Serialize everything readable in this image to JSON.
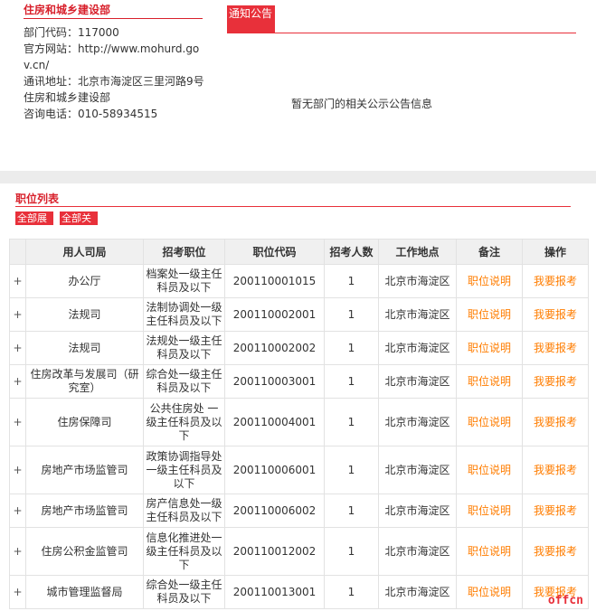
{
  "department": {
    "title": "住房和城乡建设部",
    "code_line": "部门代码：117000",
    "website_line": "官方网站：http://www.mohurd.gov.cn/",
    "address_line": "通讯地址：北京市海淀区三里河路9号住房和城乡建设部",
    "phone_line": "咨询电话：010-58934515"
  },
  "notice": {
    "tab_label": "通知公告",
    "empty_text": "暂无部门的相关公示公告信息"
  },
  "jobs": {
    "section_title": "职位列表",
    "expand_all": "全部展",
    "collapse_all": "全部关",
    "headers": [
      "用人司局",
      "招考职位",
      "职位代码",
      "招考人数",
      "工作地点",
      "备注",
      "操作"
    ],
    "rows": [
      {
        "expand": "+",
        "dept": "办公厅",
        "position": "档案处一级主任科员及以下",
        "code": "200110001015",
        "count": "1",
        "location": "北京市海淀区",
        "note": "职位说明",
        "action": "我要报考"
      },
      {
        "expand": "+",
        "dept": "法规司",
        "position": "法制协调处一级主任科员及以下",
        "code": "200110002001",
        "count": "1",
        "location": "北京市海淀区",
        "note": "职位说明",
        "action": "我要报考"
      },
      {
        "expand": "+",
        "dept": "法规司",
        "position": "法规处一级主任科员及以下",
        "code": "200110002002",
        "count": "1",
        "location": "北京市海淀区",
        "note": "职位说明",
        "action": "我要报考"
      },
      {
        "expand": "+",
        "dept": "住房改革与发展司（研究室）",
        "position": "综合处一级主任科员及以下",
        "code": "200110003001",
        "count": "1",
        "location": "北京市海淀区",
        "note": "职位说明",
        "action": "我要报考"
      },
      {
        "expand": "+",
        "dept": "住房保障司",
        "position": "公共住房处 一级主任科员及以下",
        "code": "200110004001",
        "count": "1",
        "location": "北京市海淀区",
        "note": "职位说明",
        "action": "我要报考"
      },
      {
        "expand": "+",
        "dept": "房地产市场监管司",
        "position": "政策协调指导处一级主任科员及以下",
        "code": "200110006001",
        "count": "1",
        "location": "北京市海淀区",
        "note": "职位说明",
        "action": "我要报考"
      },
      {
        "expand": "+",
        "dept": "房地产市场监管司",
        "position": "房产信息处一级主任科员及以下",
        "code": "200110006002",
        "count": "1",
        "location": "北京市海淀区",
        "note": "职位说明",
        "action": "我要报考"
      },
      {
        "expand": "+",
        "dept": "住房公积金监管司",
        "position": "信息化推进处一级主任科员及以下",
        "code": "200110012002",
        "count": "1",
        "location": "北京市海淀区",
        "note": "职位说明",
        "action": "我要报考"
      },
      {
        "expand": "+",
        "dept": "城市管理监督局",
        "position": "综合处一级主任科员及以下",
        "code": "200110013001",
        "count": "1",
        "location": "北京市海淀区",
        "note": "职位说明",
        "action": "我要报考"
      }
    ]
  },
  "watermark": "offcn",
  "colors": {
    "accent": "#e8303a",
    "link_orange": "#ff7d00",
    "header_bg": "#f0f0f0"
  }
}
